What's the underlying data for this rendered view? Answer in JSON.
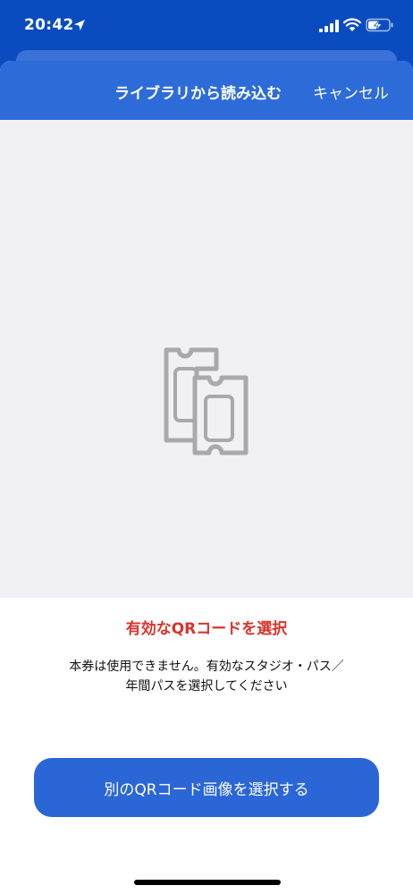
{
  "status_bar": {
    "time": "20:42",
    "icons": [
      "location-arrow-icon",
      "signal-icon",
      "wifi-icon",
      "battery-charging-icon"
    ]
  },
  "nav": {
    "title": "ライブラリから読み込む",
    "cancel_label": "キャンセル"
  },
  "preview": {
    "icon": "tickets-icon"
  },
  "error": {
    "title": "有効なQRコードを選択",
    "message_line1": "本券は使用できません。有効なスタジオ・パス／",
    "message_line2": "年間パスを選択してください"
  },
  "actions": {
    "select_another_label": "別のQRコード画像を選択する"
  },
  "colors": {
    "status_bar": "#0a4cc0",
    "nav_bar": "#2d6cd8",
    "button": "#2a66d6",
    "error_text": "#d8342c",
    "preview_bg": "#f0f0f5",
    "icon_gray": "#a9a9ad"
  }
}
